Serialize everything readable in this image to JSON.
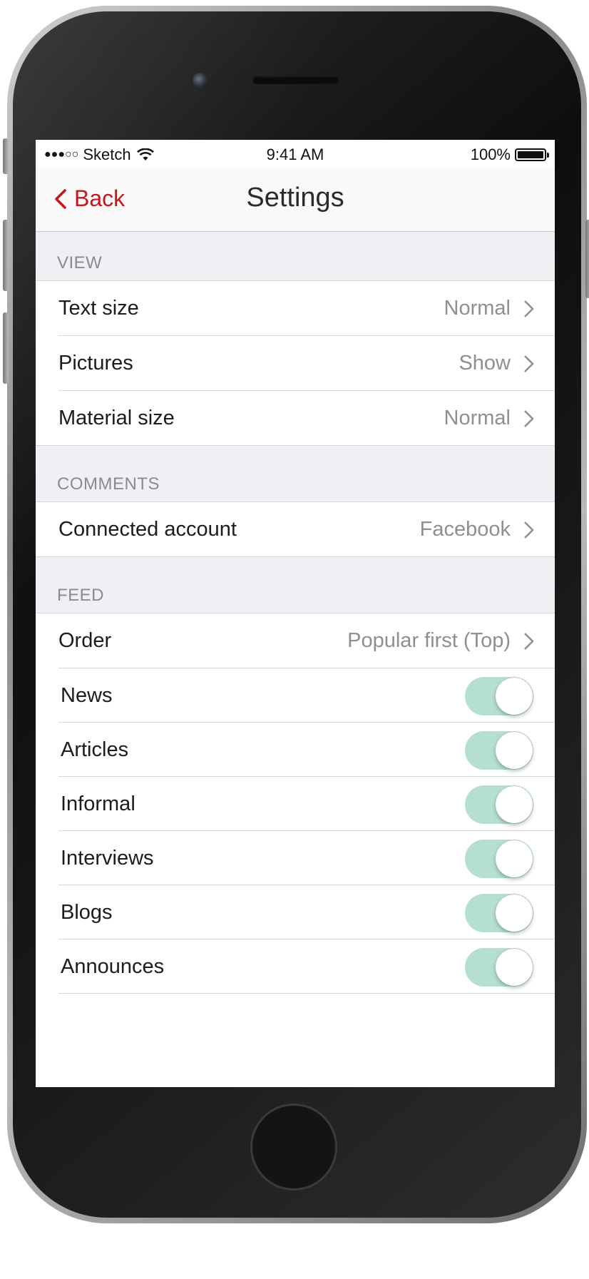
{
  "status_bar": {
    "carrier": "Sketch",
    "time": "9:41 AM",
    "battery": "100%"
  },
  "nav": {
    "back_label": "Back",
    "title": "Settings"
  },
  "sections": {
    "view": {
      "header": "VIEW",
      "rows": [
        {
          "label": "Text size",
          "value": "Normal"
        },
        {
          "label": "Pictures",
          "value": "Show"
        },
        {
          "label": "Material size",
          "value": "Normal"
        }
      ]
    },
    "comments": {
      "header": "COMMENTS",
      "rows": [
        {
          "label": "Connected account",
          "value": "Facebook"
        }
      ]
    },
    "feed": {
      "header": "FEED",
      "order": {
        "label": "Order",
        "value": "Popular first (Top)"
      },
      "toggles": [
        {
          "label": "News",
          "on": true
        },
        {
          "label": "Articles",
          "on": true
        },
        {
          "label": "Informal",
          "on": true
        },
        {
          "label": "Interviews",
          "on": true
        },
        {
          "label": "Blogs",
          "on": true
        },
        {
          "label": "Announces",
          "on": true
        }
      ]
    }
  },
  "colors": {
    "accent": "#c4161c",
    "toggle_on": "#b5dfd0",
    "section_bg": "#efeff4"
  }
}
